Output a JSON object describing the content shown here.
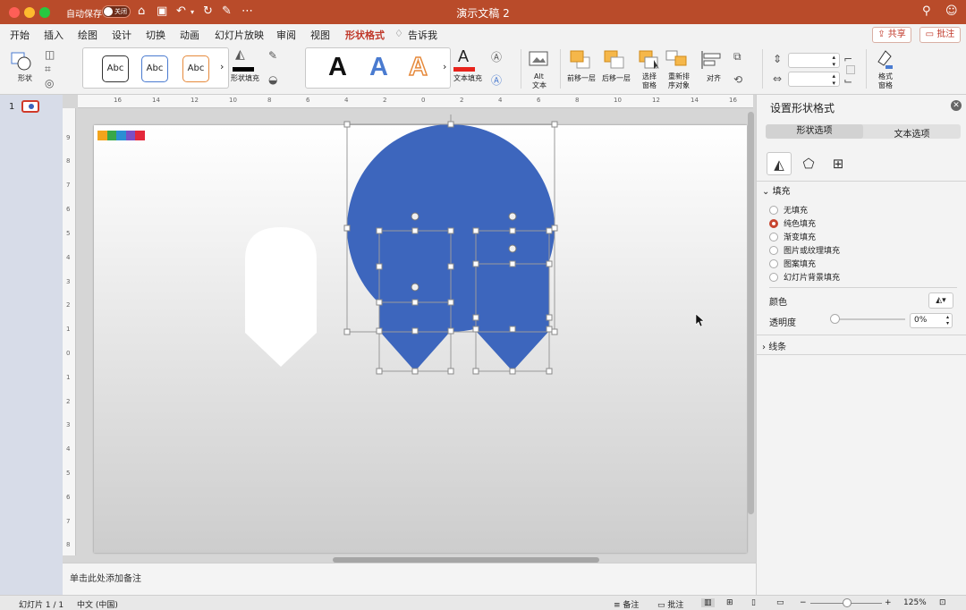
{
  "window": {
    "autosave_label": "自动保存",
    "autosave_state": "关闭",
    "title": "演示文稿 2"
  },
  "tabs": [
    "开始",
    "插入",
    "绘图",
    "设计",
    "切换",
    "动画",
    "幻灯片放映",
    "审阅",
    "视图",
    "形状格式",
    "告诉我"
  ],
  "actions": {
    "share": "共享",
    "comment": "批注"
  },
  "ribbon": {
    "shape_label": "形状",
    "style_abc": "Abc",
    "fill_label": "形状填充",
    "wordart_letter": "A",
    "text_fill_label": "文本填充",
    "alt_text_label_1": "Alt",
    "alt_text_label_2": "文本",
    "bring_forward": "前移一层",
    "send_backward": "后移一层",
    "selection_pane_1": "选择",
    "selection_pane_2": "窗格",
    "reorder_1": "重新排",
    "reorder_2": "序对象",
    "align": "对齐",
    "format_pane_1": "格式",
    "format_pane_2": "窗格"
  },
  "thumbnails": {
    "number": "1"
  },
  "rulers": {
    "h": [
      "16",
      "14",
      "12",
      "10",
      "8",
      "6",
      "4",
      "2",
      "0",
      "2",
      "4",
      "6",
      "8",
      "10",
      "12",
      "14",
      "16"
    ],
    "v": [
      "9",
      "8",
      "7",
      "6",
      "5",
      "4",
      "3",
      "2",
      "1",
      "0",
      "1",
      "2",
      "3",
      "4",
      "5",
      "6",
      "7",
      "8",
      "9"
    ]
  },
  "notes_placeholder": "单击此处添加备注",
  "panel": {
    "title": "设置形状格式",
    "tab_shape": "形状选项",
    "tab_text": "文本选项",
    "fill_section": "填充",
    "fill_options": [
      "无填充",
      "纯色填充",
      "渐变填充",
      "图片或纹理填充",
      "图案填充",
      "幻灯片背景填充"
    ],
    "fill_selected_index": 1,
    "color_label": "颜色",
    "transparency_label": "透明度",
    "transparency_value": "0%",
    "line_section": "线条"
  },
  "status": {
    "slide_count": "幻灯片 1 / 1",
    "language": "中文 (中国)",
    "notes": "备注",
    "comments": "批注",
    "zoom": "125%"
  },
  "colors": {
    "accent": "#c0392b",
    "titlebar": "#b94b2a",
    "shape_blue": "#3d66bd"
  }
}
